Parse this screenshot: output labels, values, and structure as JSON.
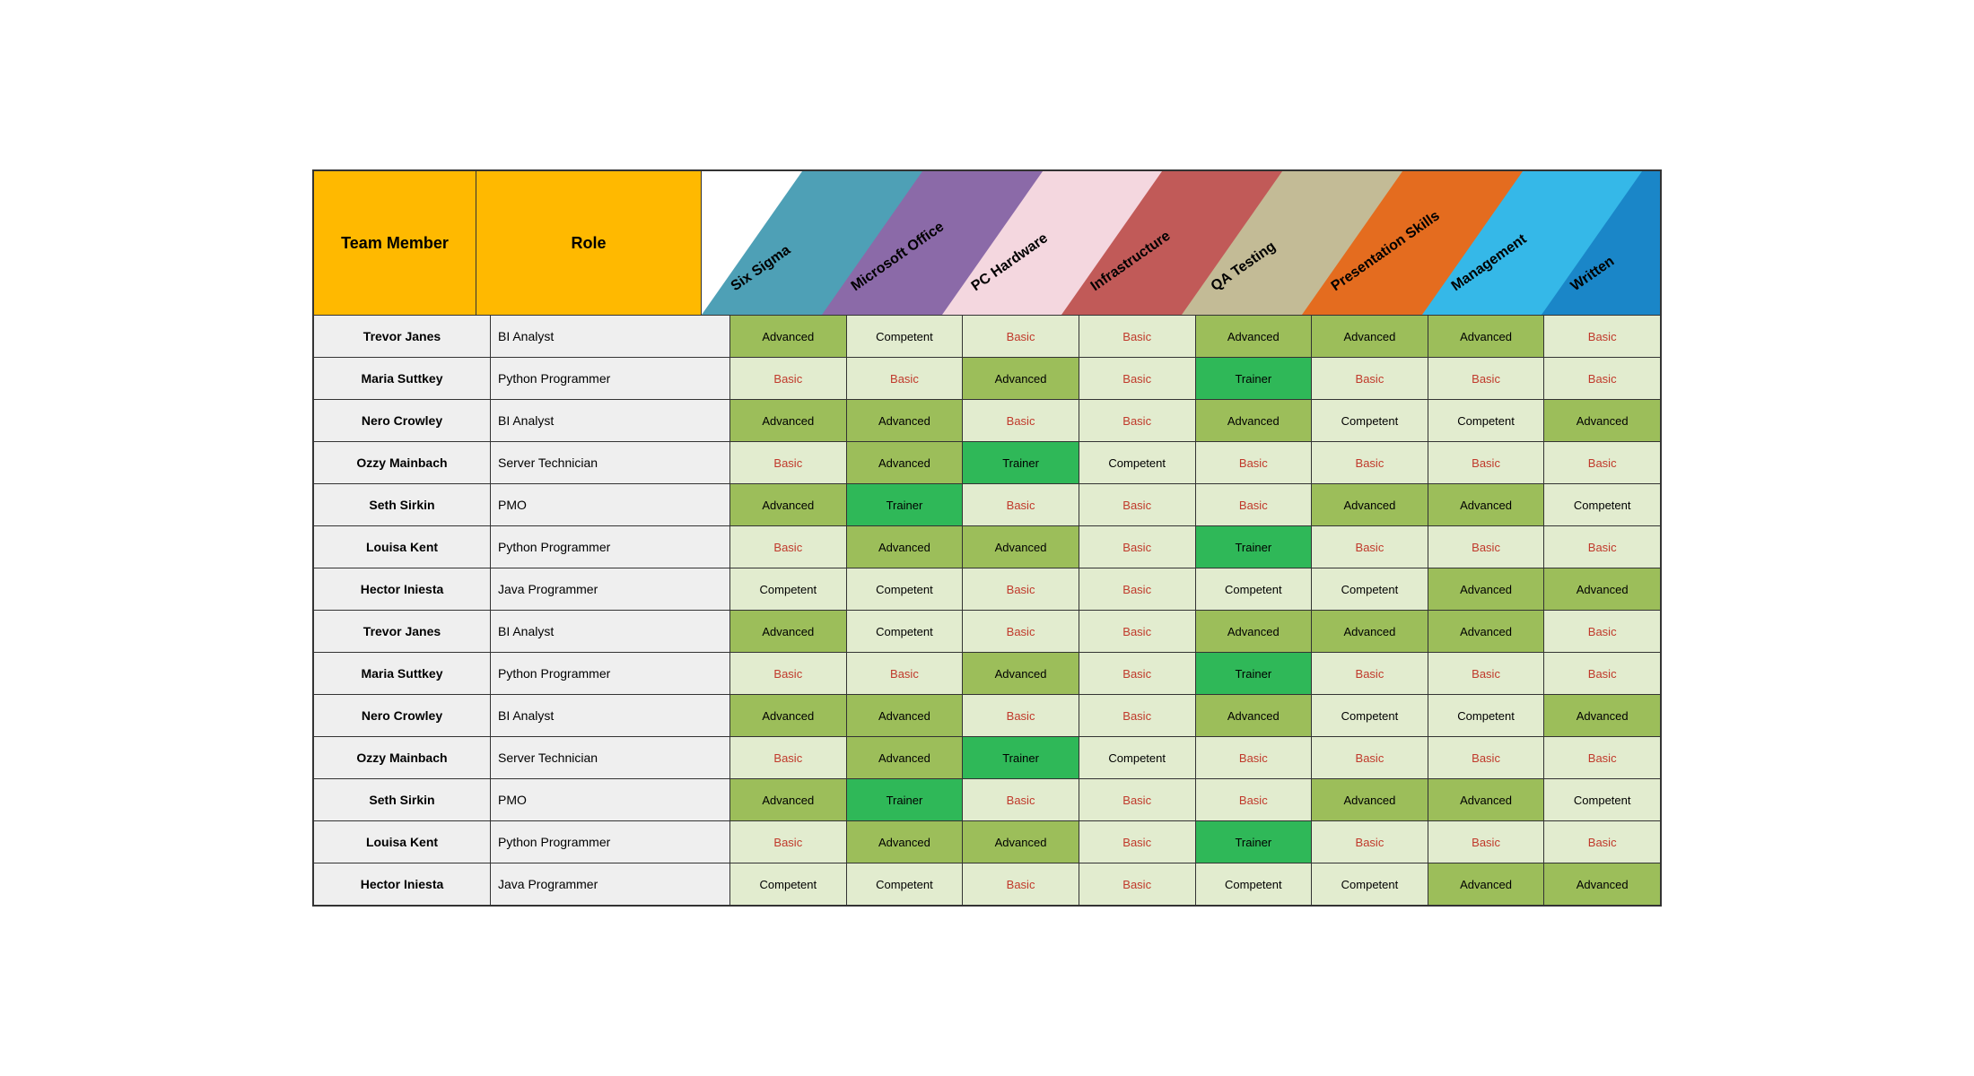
{
  "headers": {
    "team_member": "Team Member",
    "role": "Role"
  },
  "skills": [
    {
      "label": "Six Sigma",
      "color": "#4ea0b6"
    },
    {
      "label": "Microsoft Office",
      "color": "#8b6aa8"
    },
    {
      "label": "PC Hardware",
      "color": "#f4d7df"
    },
    {
      "label": "Infrastructure",
      "color": "#c15a58"
    },
    {
      "label": "QA Testing",
      "color": "#c3bb96"
    },
    {
      "label": "Presentation Skills",
      "color": "#e46c1f"
    },
    {
      "label": "Management",
      "color": "#35b8e8"
    },
    {
      "label": "Written",
      "color": "#1a86c8"
    }
  ],
  "levels": {
    "Basic": {
      "class": "level-basic"
    },
    "Competent": {
      "class": "level-competent"
    },
    "Advanced": {
      "class": "level-advanced"
    },
    "Trainer": {
      "class": "level-trainer"
    }
  },
  "rows": [
    {
      "name": "Trevor Janes",
      "role": "BI Analyst",
      "skills": [
        "Advanced",
        "Competent",
        "Basic",
        "Basic",
        "Advanced",
        "Advanced",
        "Advanced",
        "Basic"
      ]
    },
    {
      "name": "Maria Suttkey",
      "role": "Python Programmer",
      "skills": [
        "Basic",
        "Basic",
        "Advanced",
        "Basic",
        "Trainer",
        "Basic",
        "Basic",
        "Basic"
      ]
    },
    {
      "name": "Nero Crowley",
      "role": "BI Analyst",
      "skills": [
        "Advanced",
        "Advanced",
        "Basic",
        "Basic",
        "Advanced",
        "Competent",
        "Competent",
        "Advanced"
      ]
    },
    {
      "name": "Ozzy Mainbach",
      "role": "Server Technician",
      "skills": [
        "Basic",
        "Advanced",
        "Trainer",
        "Competent",
        "Basic",
        "Basic",
        "Basic",
        "Basic"
      ]
    },
    {
      "name": "Seth Sirkin",
      "role": "PMO",
      "skills": [
        "Advanced",
        "Trainer",
        "Basic",
        "Basic",
        "Basic",
        "Advanced",
        "Advanced",
        "Competent"
      ]
    },
    {
      "name": "Louisa Kent",
      "role": "Python Programmer",
      "skills": [
        "Basic",
        "Advanced",
        "Advanced",
        "Basic",
        "Trainer",
        "Basic",
        "Basic",
        "Basic"
      ]
    },
    {
      "name": "Hector Iniesta",
      "role": "Java Programmer",
      "skills": [
        "Competent",
        "Competent",
        "Basic",
        "Basic",
        "Competent",
        "Competent",
        "Advanced",
        "Advanced"
      ]
    },
    {
      "name": "Trevor Janes",
      "role": "BI Analyst",
      "skills": [
        "Advanced",
        "Competent",
        "Basic",
        "Basic",
        "Advanced",
        "Advanced",
        "Advanced",
        "Basic"
      ]
    },
    {
      "name": "Maria Suttkey",
      "role": "Python Programmer",
      "skills": [
        "Basic",
        "Basic",
        "Advanced",
        "Basic",
        "Trainer",
        "Basic",
        "Basic",
        "Basic"
      ]
    },
    {
      "name": "Nero Crowley",
      "role": "BI Analyst",
      "skills": [
        "Advanced",
        "Advanced",
        "Basic",
        "Basic",
        "Advanced",
        "Competent",
        "Competent",
        "Advanced"
      ]
    },
    {
      "name": "Ozzy Mainbach",
      "role": "Server Technician",
      "skills": [
        "Basic",
        "Advanced",
        "Trainer",
        "Competent",
        "Basic",
        "Basic",
        "Basic",
        "Basic"
      ]
    },
    {
      "name": "Seth Sirkin",
      "role": "PMO",
      "skills": [
        "Advanced",
        "Trainer",
        "Basic",
        "Basic",
        "Basic",
        "Advanced",
        "Advanced",
        "Competent"
      ]
    },
    {
      "name": "Louisa Kent",
      "role": "Python Programmer",
      "skills": [
        "Basic",
        "Advanced",
        "Advanced",
        "Basic",
        "Trainer",
        "Basic",
        "Basic",
        "Basic"
      ]
    },
    {
      "name": "Hector Iniesta",
      "role": "Java Programmer",
      "skills": [
        "Competent",
        "Competent",
        "Basic",
        "Basic",
        "Competent",
        "Competent",
        "Advanced",
        "Advanced"
      ]
    }
  ]
}
